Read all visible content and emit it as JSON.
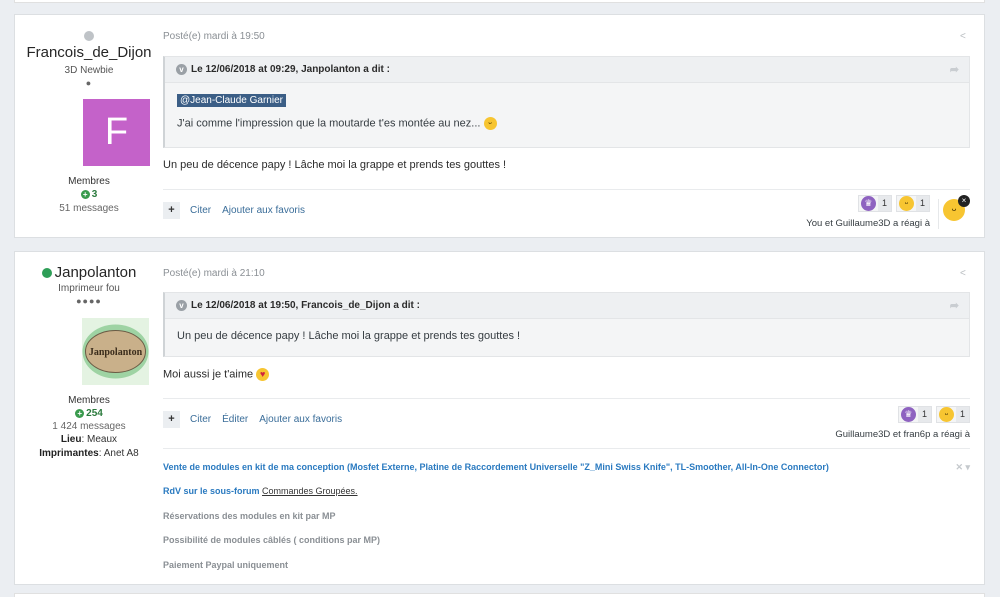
{
  "posts": [
    {
      "author": {
        "name": "Francois_de_Dijon",
        "title": "3D Newbie",
        "rank_pips": "●",
        "avatar_letter": "F",
        "group": "Membres",
        "reputation": "3",
        "message_count": "51 messages"
      },
      "meta": "Posté(e) mardi à 19:50",
      "quote": {
        "header": "Le 12/06/2018 at 09:29, Janpolanton a dit :",
        "mention": "@Jean-Claude Garnier",
        "text": "J'ai comme l'impression que la moutarde t'es montée au nez..."
      },
      "text": "Un peu de décence papy ! Lâche moi la grappe et prends tes gouttes !",
      "controls": [
        "Citer",
        "Ajouter aux favoris"
      ],
      "reactions": [
        {
          "icon": "trophy-icon",
          "count": "1"
        },
        {
          "icon": "laugh-icon",
          "count": "1"
        }
      ],
      "reaction_summary": "You et Guillaume3D a réagi à"
    },
    {
      "author": {
        "name": "Janpolanton",
        "title": "Imprimeur fou",
        "rank_pips": "●●●●",
        "avatar_text": "Janpolanton",
        "group": "Membres",
        "reputation": "254",
        "message_count": "1 424 messages",
        "location_label": "Lieu",
        "location": ": Meaux",
        "printers_label": "Imprimantes",
        "printers": ": Anet A8"
      },
      "meta": "Posté(e) mardi à 21:10",
      "quote": {
        "header": "Le 12/06/2018 at 19:50, Francois_de_Dijon a dit :",
        "text": "Un peu de décence papy ! Lâche moi la grappe et prends tes gouttes !"
      },
      "text": "Moi aussi je t'aime",
      "controls": [
        "Citer",
        "Éditer",
        "Ajouter aux favoris"
      ],
      "reactions": [
        {
          "icon": "trophy-icon",
          "count": "1"
        },
        {
          "icon": "laugh-icon",
          "count": "1"
        }
      ],
      "reaction_summary": "Guillaume3D et fran6p a réagi à",
      "signature": {
        "line1": "Vente de modules en kit de ma conception (Mosfet Externe, Platine de Raccordement Universelle \"Z_Mini Swiss Knife\", TL-Smoother, All-In-One Connector)",
        "line2_prefix": "RdV sur le sous-forum ",
        "line2_link": "Commandes Groupées.",
        "line3": "Réservations des modules en kit par MP",
        "line4": "Possibilité de modules câblés ( conditions par MP)",
        "line5": "Paiement Paypal uniquement"
      }
    }
  ],
  "colors": {
    "avatar_bg": "#c462c9",
    "online": "#2e9e57",
    "offline": "#bfc3c7",
    "link": "#3a6d99",
    "signature_blue": "#2a7ac0"
  }
}
